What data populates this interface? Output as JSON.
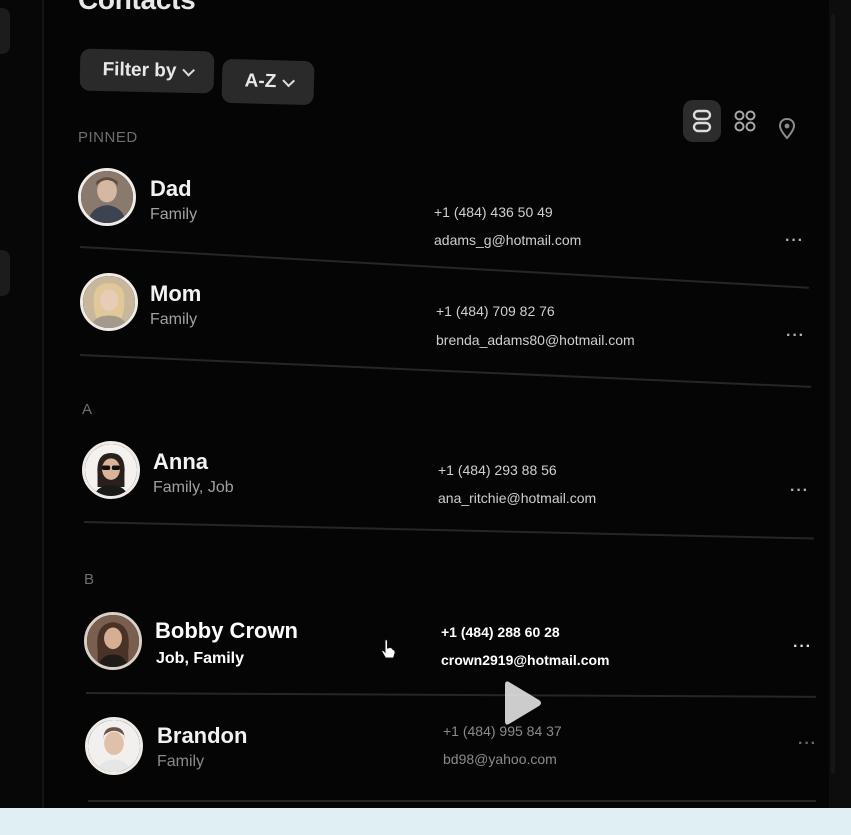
{
  "header": {
    "title": "Contacts"
  },
  "toolbar": {
    "filter_label": "Filter by",
    "sort_label": "A-Z",
    "views": [
      "list-view-icon",
      "grid-view-icon",
      "map-pin-icon"
    ]
  },
  "sections": [
    {
      "label": "PINNED",
      "contacts": [
        {
          "name": "Dad",
          "tags": "Family",
          "phone": "+1 (484) 436 50 49",
          "email": "adams_g@hotmail.com"
        },
        {
          "name": "Mom",
          "tags": "Family",
          "phone": "+1 (484) 709 82 76",
          "email": "brenda_adams80@hotmail.com"
        }
      ]
    },
    {
      "label": "A",
      "contacts": [
        {
          "name": "Anna",
          "tags": "Family, Job",
          "phone": "+1 (484) 293 88 56",
          "email": "ana_ritchie@hotmail.com"
        }
      ]
    },
    {
      "label": "B",
      "contacts": [
        {
          "name": "Bobby Crown",
          "tags": "Job, Family",
          "phone": "+1 (484) 288 60 28",
          "email": "crown2919@hotmail.com"
        },
        {
          "name": "Brandon",
          "tags": "Family",
          "phone": "+1 (484) 995 84 37",
          "email": "bd98@yahoo.com"
        }
      ]
    }
  ],
  "row_actions": {
    "more_label": "···"
  },
  "colors": {
    "background": "#050505",
    "button": "#2a2a2a",
    "divider": "#262626",
    "page_outside": "#dfeff3"
  }
}
